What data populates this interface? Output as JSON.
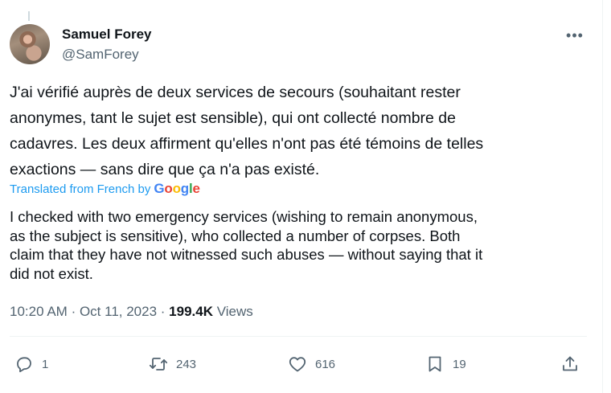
{
  "tweet": {
    "author_name": "Samuel Forey",
    "author_handle": "@SamForey",
    "text_lines": [
      "J'ai vérifié auprès de deux services de secours (souhaitant rester",
      "anonymes, tant le sujet est sensible), qui ont collecté nombre de",
      "cadavres. Les deux affirment qu'elles n'ont pas été témoins de telles",
      "exactions — sans dire que ça n'a pas existé."
    ],
    "translated_label": "Translated from French by",
    "translation_lines": [
      "I checked with two emergency services (wishing to remain anonymous,",
      "as the subject is sensitive), who collected a number of corpses. Both",
      "claim that they have not witnessed such abuses — without saying that it",
      "did not exist."
    ],
    "time": "10:20 AM",
    "date": "Oct 11, 2023",
    "views_count": "199.4K",
    "views_label": "Views"
  },
  "actions": {
    "reply_count": "1",
    "retweet_count": "243",
    "like_count": "616",
    "bookmark_count": "19"
  },
  "icons": {
    "reply": "reply-icon",
    "retweet": "retweet-icon",
    "like": "heart-icon",
    "bookmark": "bookmark-icon",
    "share": "share-icon",
    "more": "more-icon"
  },
  "colors": {
    "link": "#1d9bf0",
    "secondary_text": "#536471",
    "primary_text": "#0f1419"
  }
}
